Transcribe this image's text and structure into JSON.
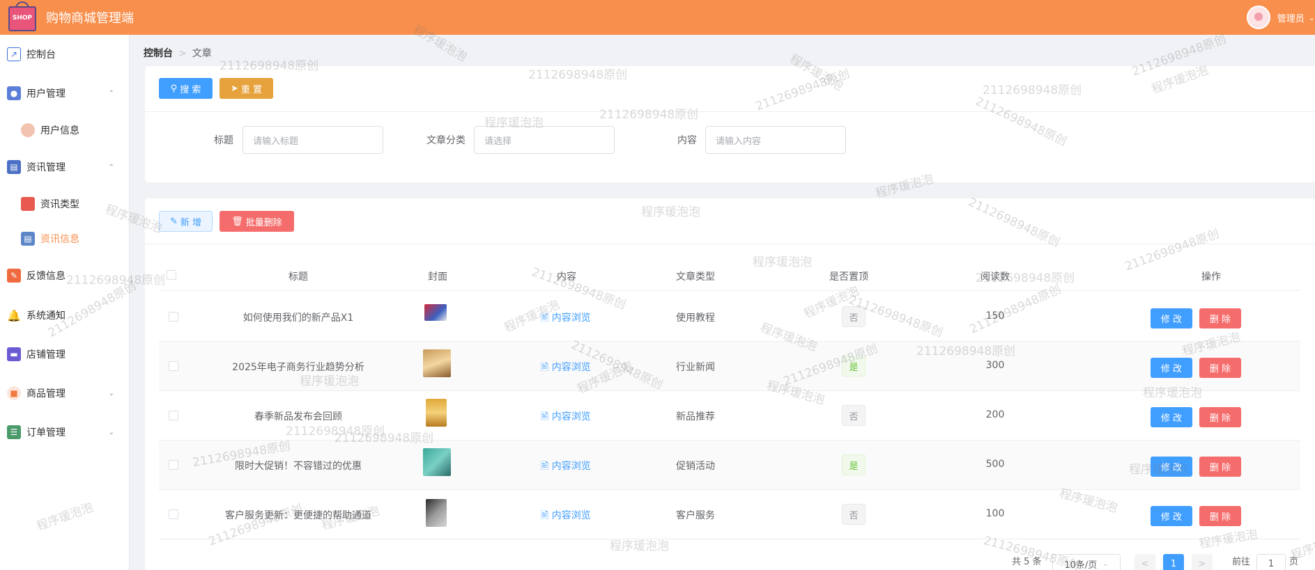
{
  "header": {
    "logo_text": "SHOP",
    "title": "购物商城管理端",
    "user": "管理员"
  },
  "sidebar": {
    "items": [
      {
        "label": "控制台"
      },
      {
        "label": "用户管理"
      },
      {
        "label": "用户信息"
      },
      {
        "label": "资讯管理"
      },
      {
        "label": "资讯类型"
      },
      {
        "label": "资讯信息"
      },
      {
        "label": "反馈信息"
      },
      {
        "label": "系统通知"
      },
      {
        "label": "店铺管理"
      },
      {
        "label": "商品管理"
      },
      {
        "label": "订单管理"
      }
    ]
  },
  "breadcrumb": {
    "home": "控制台",
    "current": "文章"
  },
  "search": {
    "search_label": "搜 索",
    "reset_label": "重 置",
    "title_label": "标题",
    "title_placeholder": "请输入标题",
    "category_label": "文章分类",
    "category_placeholder": "请选择",
    "content_label": "内容",
    "content_placeholder": "请输入内容"
  },
  "toolbar": {
    "add_label": "新 增",
    "batch_delete_label": "批量删除"
  },
  "table": {
    "headers": [
      "标题",
      "封面",
      "内容",
      "文章类型",
      "是否置顶",
      "阅读数",
      "操作"
    ],
    "rows": [
      {
        "title": "如何使用我们的新产品X1",
        "content": "内容浏览",
        "type": "使用教程",
        "top": "否",
        "reads": "150"
      },
      {
        "title": "2025年电子商务行业趋势分析",
        "content": "内容浏览",
        "type": "行业新闻",
        "top": "是",
        "reads": "300"
      },
      {
        "title": "春季新品发布会回顾",
        "content": "内容浏览",
        "type": "新品推荐",
        "top": "否",
        "reads": "200"
      },
      {
        "title": "限时大促销！不容错过的优惠",
        "content": "内容浏览",
        "type": "促销活动",
        "top": "是",
        "reads": "500"
      },
      {
        "title": "客户服务更新：更便捷的帮助通道",
        "content": "内容浏览",
        "type": "客户服务",
        "top": "否",
        "reads": "100"
      }
    ],
    "edit_label": "修 改",
    "delete_label": "删 除"
  },
  "pagination": {
    "total": "共 5 条",
    "page_size": "10条/页",
    "current": "1",
    "goto_prefix": "前往",
    "goto_value": "1",
    "goto_suffix": "页"
  },
  "watermarks": [
    "2112698948原创",
    "程序瑗泡泡"
  ],
  "colors": {
    "header": "#f98f4c",
    "primary": "#409eff",
    "danger": "#f56c6c",
    "warning": "#e6a23c",
    "active_menu": "#f98f4c"
  }
}
